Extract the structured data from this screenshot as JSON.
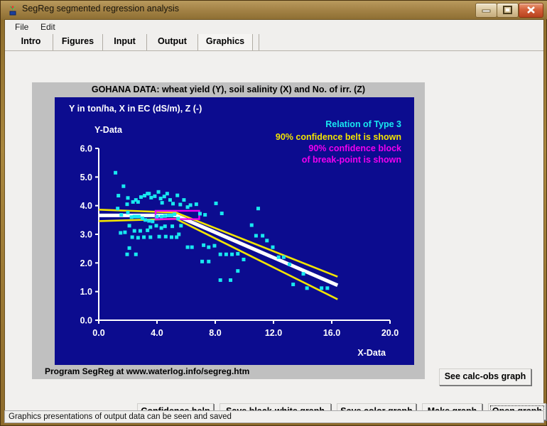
{
  "window": {
    "title": "SegReg segmented regression analysis",
    "icon": "plant-icon",
    "controls": {
      "minimize": "minimize-icon",
      "maximize": "maximize-icon",
      "close": "close-icon"
    }
  },
  "menubar": {
    "items": [
      {
        "label": "File"
      },
      {
        "label": "Edit"
      }
    ]
  },
  "tabs": [
    {
      "label": "Intro",
      "active": false
    },
    {
      "label": "Figures",
      "active": false
    },
    {
      "label": "Input",
      "active": false
    },
    {
      "label": "Output",
      "active": false
    },
    {
      "label": "Graphics",
      "active": true
    }
  ],
  "graph": {
    "title": "GOHANA DATA: wheat yield (Y), soil salinity (X) and No. of irr. (Z)",
    "footer": "Program SegReg at www.waterlog.info/segreg.htm"
  },
  "buttons": {
    "calc_obs": "See calc-obs graph",
    "confidence_help": "Confidence help",
    "save_bw": "Save black-white graph",
    "save_color": "Save color graph",
    "make_graph": "Make graph",
    "open_graph": "Open graph"
  },
  "statusbar": {
    "text": "Graphics presentations of output data can be seen and saved"
  },
  "colors": {
    "plot_background": "#0c0c8f",
    "panel_background": "#c0c0c0",
    "points": "#18e8f0",
    "regression_line": "#ffffff",
    "confidence_belt": "#f2e400",
    "confidence_block": "#f000f0",
    "legend_type": "#18e8f0",
    "legend_belt": "#f2e400",
    "legend_block": "#f000f0",
    "axis": "#ffffff",
    "title_bar": "#a8874a"
  },
  "chart_data": {
    "type": "scatter",
    "title": "GOHANA DATA: wheat yield (Y), soil salinity (X) and No. of irr. (Z)",
    "subtitle": "Y in ton/ha, X in EC (dS/m), Z (-)",
    "xlabel": "X-Data",
    "ylabel": "Y-Data",
    "xlim": [
      0.0,
      20.0
    ],
    "ylim": [
      0.0,
      6.0
    ],
    "xticks": [
      "0.0",
      "4.0",
      "8.0",
      "12.0",
      "16.0",
      "20.0"
    ],
    "yticks": [
      "0.0",
      "1.0",
      "2.0",
      "3.0",
      "4.0",
      "5.0",
      "6.0"
    ],
    "grid": false,
    "legend_position": "top-right",
    "annotations": [
      {
        "text": "Relation of Type 3",
        "color": "#18e8f0"
      },
      {
        "text": "90% confidence belt is shown",
        "color": "#f2e400"
      },
      {
        "text": "90% confidence block",
        "color": "#f000f0"
      },
      {
        "text": "of break-point is shown",
        "color": "#f000f0"
      }
    ],
    "breakpoint": {
      "x": 5.3,
      "y": 3.66
    },
    "breakpoint_block": {
      "x_min": 3.9,
      "x_max": 6.9,
      "y_min": 3.53,
      "y_max": 3.82
    },
    "segments": [
      {
        "name": "segment-1",
        "x_start": 0.0,
        "y_start": 3.66,
        "x_end": 5.3,
        "y_end": 3.66
      },
      {
        "name": "segment-2",
        "x_start": 5.3,
        "y_start": 3.66,
        "x_end": 16.4,
        "y_end": 1.22
      }
    ],
    "confidence_belt_upper": [
      {
        "x": 0.0,
        "y": 3.86
      },
      {
        "x": 5.3,
        "y": 3.76
      },
      {
        "x": 16.4,
        "y": 1.52
      }
    ],
    "confidence_belt_lower": [
      {
        "x": 0.0,
        "y": 3.46
      },
      {
        "x": 5.3,
        "y": 3.54
      },
      {
        "x": 16.4,
        "y": 0.73
      }
    ],
    "series": [
      {
        "name": "observations",
        "color": "#18e8f0",
        "points": [
          [
            1.15,
            5.15
          ],
          [
            1.35,
            4.35
          ],
          [
            1.7,
            4.68
          ],
          [
            1.95,
            4.05
          ],
          [
            1.3,
            3.9
          ],
          [
            2.55,
            4.2
          ],
          [
            2.0,
            4.27
          ],
          [
            2.35,
            4.13
          ],
          [
            2.7,
            4.13
          ],
          [
            2.9,
            4.3
          ],
          [
            3.15,
            4.35
          ],
          [
            3.35,
            4.42
          ],
          [
            3.45,
            4.42
          ],
          [
            3.6,
            4.28
          ],
          [
            3.85,
            4.33
          ],
          [
            4.1,
            4.48
          ],
          [
            4.25,
            4.25
          ],
          [
            4.35,
            4.1
          ],
          [
            4.5,
            4.32
          ],
          [
            4.7,
            4.42
          ],
          [
            4.9,
            4.2
          ],
          [
            5.1,
            4.07
          ],
          [
            5.4,
            4.36
          ],
          [
            5.6,
            4.04
          ],
          [
            5.85,
            4.2
          ],
          [
            6.1,
            3.95
          ],
          [
            6.3,
            4.02
          ],
          [
            1.55,
            3.68
          ],
          [
            2.0,
            3.76
          ],
          [
            2.25,
            3.6
          ],
          [
            2.45,
            3.62
          ],
          [
            2.6,
            3.62
          ],
          [
            2.75,
            3.62
          ],
          [
            3.0,
            3.56
          ],
          [
            3.2,
            3.5
          ],
          [
            3.45,
            3.47
          ],
          [
            3.7,
            3.45
          ],
          [
            4.0,
            3.62
          ],
          [
            4.3,
            3.62
          ],
          [
            4.55,
            3.64
          ],
          [
            4.8,
            3.66
          ],
          [
            5.0,
            3.66
          ],
          [
            5.2,
            3.7
          ],
          [
            5.45,
            3.55
          ],
          [
            5.65,
            3.3
          ],
          [
            2.1,
            3.3
          ],
          [
            2.45,
            3.12
          ],
          [
            2.85,
            3.12
          ],
          [
            3.35,
            3.14
          ],
          [
            3.55,
            3.25
          ],
          [
            3.95,
            3.3
          ],
          [
            4.3,
            3.22
          ],
          [
            4.55,
            3.28
          ],
          [
            5.05,
            3.28
          ],
          [
            5.5,
            3.0
          ],
          [
            1.5,
            3.05
          ],
          [
            1.8,
            3.07
          ],
          [
            2.3,
            2.9
          ],
          [
            2.7,
            2.88
          ],
          [
            3.1,
            2.9
          ],
          [
            3.55,
            2.9
          ],
          [
            4.15,
            2.92
          ],
          [
            4.6,
            2.92
          ],
          [
            5.0,
            2.9
          ],
          [
            5.35,
            2.9
          ],
          [
            2.1,
            2.52
          ],
          [
            1.95,
            2.3
          ],
          [
            2.55,
            2.3
          ],
          [
            6.1,
            2.55
          ],
          [
            6.4,
            2.55
          ],
          [
            7.2,
            2.62
          ],
          [
            7.55,
            2.55
          ],
          [
            7.95,
            2.6
          ],
          [
            8.35,
            2.3
          ],
          [
            8.75,
            2.3
          ],
          [
            9.15,
            2.3
          ],
          [
            9.55,
            2.32
          ],
          [
            9.95,
            2.12
          ],
          [
            9.55,
            1.72
          ],
          [
            8.35,
            1.4
          ],
          [
            9.05,
            1.4
          ],
          [
            10.5,
            3.32
          ],
          [
            10.8,
            2.95
          ],
          [
            11.25,
            2.95
          ],
          [
            11.55,
            2.78
          ],
          [
            11.95,
            2.55
          ],
          [
            12.35,
            2.2
          ],
          [
            12.7,
            2.2
          ],
          [
            13.1,
            1.95
          ],
          [
            14.05,
            1.62
          ],
          [
            13.35,
            1.25
          ],
          [
            14.3,
            1.12
          ],
          [
            15.3,
            1.12
          ],
          [
            15.7,
            1.12
          ],
          [
            6.95,
            3.72
          ],
          [
            7.3,
            3.68
          ],
          [
            7.1,
            2.05
          ],
          [
            7.55,
            2.05
          ],
          [
            6.7,
            4.05
          ],
          [
            10.95,
            3.9
          ],
          [
            8.05,
            4.08
          ],
          [
            8.45,
            3.73
          ]
        ]
      }
    ]
  }
}
